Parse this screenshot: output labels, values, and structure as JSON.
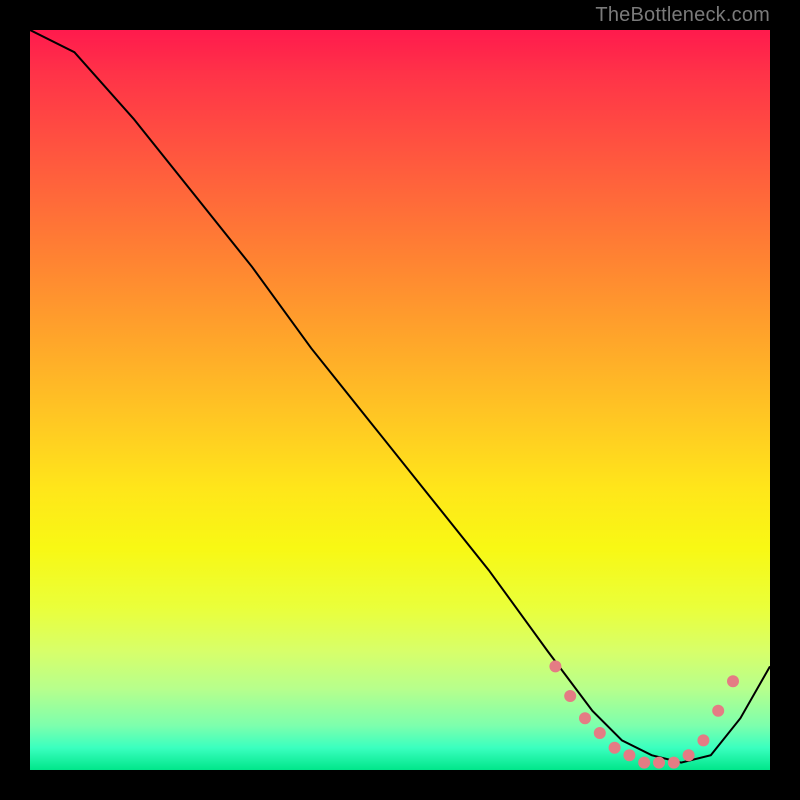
{
  "watermark": "TheBottleneck.com",
  "chart_data": {
    "type": "line",
    "title": "",
    "xlabel": "",
    "ylabel": "",
    "xlim": [
      0,
      100
    ],
    "ylim": [
      0,
      100
    ],
    "x": [
      0,
      6,
      14,
      22,
      30,
      38,
      46,
      54,
      62,
      70,
      76,
      80,
      84,
      88,
      92,
      96,
      100
    ],
    "values": [
      100,
      97,
      88,
      78,
      68,
      57,
      47,
      37,
      27,
      16,
      8,
      4,
      2,
      1,
      2,
      7,
      14
    ],
    "markers_x": [
      71,
      73,
      75,
      77,
      79,
      81,
      83,
      85,
      87,
      89,
      91,
      93,
      95
    ],
    "markers_y": [
      14,
      10,
      7,
      5,
      3,
      2,
      1,
      1,
      1,
      2,
      4,
      8,
      12
    ],
    "marker_color": "#e47c84",
    "curve_color": "#000000"
  }
}
